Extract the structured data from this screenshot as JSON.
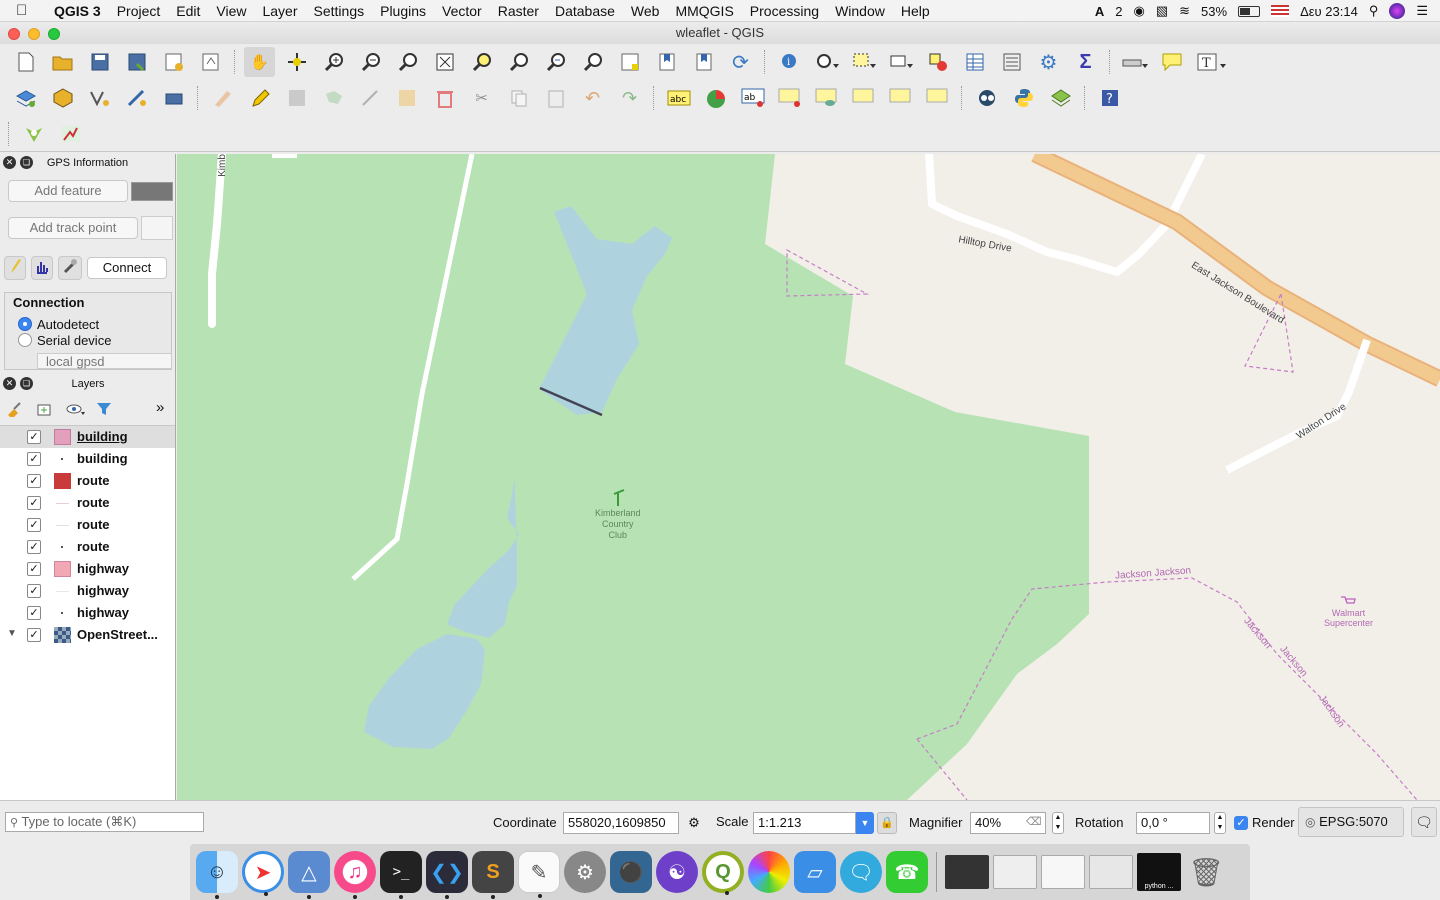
{
  "menubar": {
    "app_name": "QGIS 3",
    "items": [
      "Project",
      "Edit",
      "View",
      "Layer",
      "Settings",
      "Plugins",
      "Vector",
      "Raster",
      "Database",
      "Web",
      "MMQGIS",
      "Processing",
      "Window",
      "Help"
    ],
    "status": {
      "desktop_number": "2",
      "battery": "53%",
      "clock": "Δευ 23:14"
    }
  },
  "window": {
    "title": "wleaflet - QGIS"
  },
  "gps_panel": {
    "title": "GPS Information",
    "add_feature": "Add feature",
    "add_track_point": "Add track point",
    "connect": "Connect",
    "connection_label": "Connection",
    "options": [
      "Autodetect",
      "Serial device"
    ],
    "selected_option": "Autodetect",
    "local_gpsd": "local gpsd"
  },
  "layers_panel": {
    "title": "Layers",
    "layers": [
      {
        "name": "building",
        "color": "#e3a0bc",
        "style": "fill",
        "checked": true,
        "selected": true
      },
      {
        "name": "building",
        "color": "#555555",
        "style": "dot",
        "checked": true
      },
      {
        "name": "route",
        "color": "#c93b3b",
        "style": "fill",
        "checked": true
      },
      {
        "name": "route",
        "color": "#c88888",
        "style": "line",
        "checked": true
      },
      {
        "name": "route",
        "color": "#999999",
        "style": "line",
        "checked": true
      },
      {
        "name": "route",
        "color": "#555555",
        "style": "dot",
        "checked": true
      },
      {
        "name": "highway",
        "color": "#f2a8b4",
        "style": "fill",
        "checked": true
      },
      {
        "name": "highway",
        "color": "#bbbbbb",
        "style": "line",
        "checked": true
      },
      {
        "name": "highway",
        "color": "#555555",
        "style": "dot",
        "checked": true
      },
      {
        "name": "OpenStreet...",
        "color": "#3a5a8a",
        "style": "raster",
        "checked": true
      }
    ]
  },
  "map": {
    "labels": {
      "hilltop": "Hilltop Drive",
      "east_jackson": "East Jackson Boulevard",
      "walton": "Walton Drive",
      "country_club": [
        "Kimberland",
        "Country",
        "Club"
      ],
      "jackson_jackson": "Jackson Jackson",
      "jackson1": "Jackson",
      "jackson2": "Jackson",
      "jackson3": "Jackson",
      "walmart": [
        "Walmart",
        "Supercenter"
      ],
      "kimb": "Kimb"
    }
  },
  "statusbar": {
    "locate_placeholder": "Type to locate (⌘K)",
    "coordinate_label": "Coordinate",
    "coordinate": "558020,1609850",
    "scale_label": "Scale",
    "scale": "1:1.213",
    "magnifier_label": "Magnifier",
    "magnifier": "40%",
    "rotation_label": "Rotation",
    "rotation": "0,0 °",
    "render_label": "Render",
    "crs": "EPSG:5070"
  },
  "dock": {
    "python_label": "python ..."
  },
  "colors": {
    "park": "#b6e2b4",
    "water": "#aed3df",
    "land": "#f2efe9",
    "road_primary": "#f2c98e",
    "route_magenta": "#c77dc7"
  }
}
